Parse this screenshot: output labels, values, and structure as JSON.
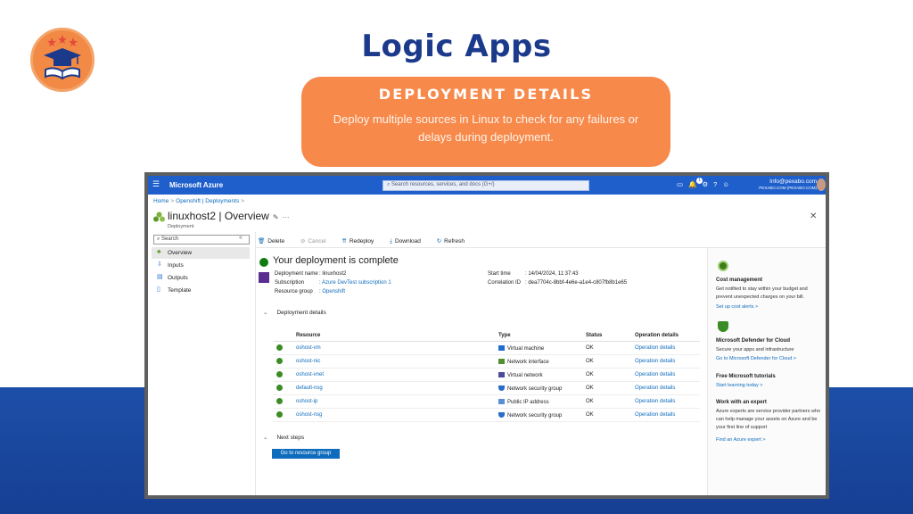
{
  "slide": {
    "title": "Logic Apps",
    "card_heading": "DEPLOYMENT DETAILS",
    "card_text": "Deploy multiple sources in Linux to check for any failures or delays during deployment."
  },
  "topbar": {
    "menu_icon": "hamburger-icon",
    "brand": "Microsoft Azure",
    "search_placeholder": "Search resources, services, and docs (G+/)",
    "notification_count": "1",
    "user_email": "Info@pexabo.com",
    "user_tenant": "PEXABO.COM (PEXABO.COM)"
  },
  "breadcrumb": {
    "home": "Home",
    "sep": ">",
    "item": "Openshift | Deployments",
    "trail": ">"
  },
  "resource": {
    "title": "linuxhost2 | Overview",
    "pin": "✎",
    "more": "···",
    "subtitle": "Deployment",
    "close": "✕"
  },
  "sidebar": {
    "search_placeholder": "Search",
    "collapse": "«",
    "items": [
      {
        "label": "Overview",
        "icon": "overview-icon"
      },
      {
        "label": "Inputs",
        "icon": "inputs-icon"
      },
      {
        "label": "Outputs",
        "icon": "outputs-icon"
      },
      {
        "label": "Template",
        "icon": "template-icon"
      }
    ]
  },
  "toolbar": {
    "delete": "Delete",
    "cancel": "Cancel",
    "redeploy": "Redeploy",
    "download": "Download",
    "refresh": "Refresh"
  },
  "overview": {
    "status_title": "Your deployment is complete",
    "deployment_name_label": "Deployment name",
    "deployment_name": "linuxhost2",
    "subscription_label": "Subscription",
    "subscription": "Azure DevTest subscription 1",
    "resource_group_label": "Resource group",
    "resource_group": "Openshift",
    "start_time_label": "Start time",
    "start_time": "14/04/2024, 11:37:43",
    "correlation_label": "Correlation ID",
    "correlation_id": "dea7704c-8bbf-4e6e-a1e4-c807fb8b1e65",
    "colon": ":"
  },
  "deployment_details": {
    "chevron": "⌄",
    "title": "Deployment details",
    "columns": [
      "Resource",
      "Type",
      "Status",
      "Operation details"
    ],
    "rows": [
      {
        "resource": "oshost-vm",
        "type": "Virtual machine",
        "type_color": "#1f6fd1",
        "status": "OK",
        "op": "Operation details"
      },
      {
        "resource": "oshost-nic",
        "type": "Network interface",
        "type_color": "#4f8f2f",
        "status": "OK",
        "op": "Operation details"
      },
      {
        "resource": "oshost-vnet",
        "type": "Virtual network",
        "type_color": "#4b4b9b",
        "status": "OK",
        "op": "Operation details"
      },
      {
        "resource": "default-nsg",
        "type": "Network security group",
        "type_color": "#2a6cc9",
        "status": "OK",
        "op": "Operation details"
      },
      {
        "resource": "oshost-ip",
        "type": "Public IP address",
        "type_color": "#5a8fd8",
        "status": "OK",
        "op": "Operation details"
      },
      {
        "resource": "oshost-nsg",
        "type": "Network security group",
        "type_color": "#2a6cc9",
        "status": "OK",
        "op": "Operation details"
      }
    ]
  },
  "next_steps": {
    "chevron": "⌄",
    "title": "Next steps",
    "button": "Go to resource group"
  },
  "right_panel": {
    "cost_title": "Cost management",
    "cost_text": "Get notified to stay within your budget and prevent unexpected charges on your bill.",
    "cost_link": "Set up cost alerts >",
    "defender_title": "Microsoft Defender for Cloud",
    "defender_text": "Secure your apps and infrastructure",
    "defender_link": "Go to Microsoft Defender for Cloud >",
    "tutorials_title": "Free Microsoft tutorials",
    "tutorials_link": "Start learning today >",
    "expert_title": "Work with an expert",
    "expert_text": "Azure experts are service provider partners who can help manage your assets on Azure and be your first line of support",
    "expert_link": "Find an Azure expert >"
  },
  "colors": {
    "azure_blue": "#1f5fcc",
    "link": "#0f6cbd",
    "success": "#107c10",
    "slide_orange": "#f7894a",
    "slide_navy": "#1b3a8c"
  }
}
